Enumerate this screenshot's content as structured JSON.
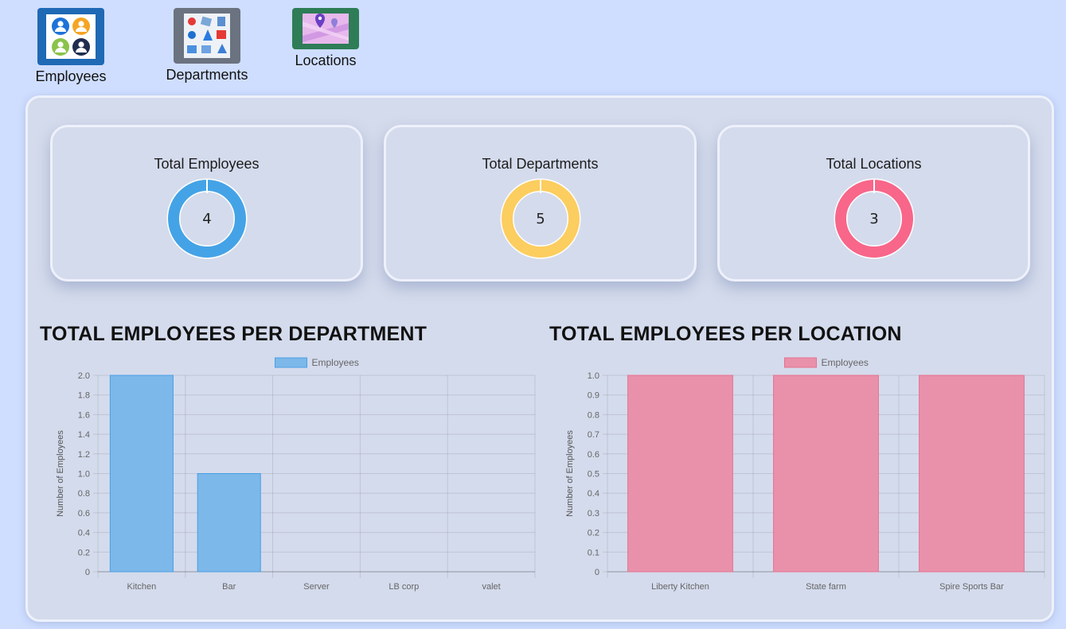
{
  "nav": {
    "items": [
      {
        "label": "Employees",
        "icon": "employees-avatars-icon",
        "color": "#1f69b5"
      },
      {
        "label": "Departments",
        "icon": "departments-grid-icon",
        "color": "#6b7280"
      },
      {
        "label": "Locations",
        "icon": "locations-map-pin-icon",
        "color": "#2e7d57"
      }
    ]
  },
  "stats": [
    {
      "title": "Total Employees",
      "value": "4",
      "color": "#44a3e6"
    },
    {
      "title": "Total Departments",
      "value": "5",
      "color": "#fccd5f"
    },
    {
      "title": "Total Locations",
      "value": "3",
      "color": "#f8668a"
    }
  ],
  "charts": {
    "department": {
      "title": "TOTAL EMPLOYEES PER DEPARTMENT"
    },
    "location": {
      "title": "TOTAL EMPLOYEES PER LOCATION"
    }
  },
  "chart_data": [
    {
      "type": "bar",
      "title": "TOTAL EMPLOYEES PER DEPARTMENT",
      "xlabel": "",
      "ylabel": "Number of Employees",
      "categories": [
        "Kitchen",
        "Bar",
        "Server",
        "LB corp",
        "valet"
      ],
      "series": [
        {
          "name": "Employees",
          "values": [
            2,
            1,
            0,
            0,
            0
          ]
        }
      ],
      "ylim": [
        0,
        2.0
      ],
      "yticks": [
        "0",
        "0.2",
        "0.4",
        "0.6",
        "0.8",
        "1.0",
        "1.2",
        "1.4",
        "1.6",
        "1.8",
        "2.0"
      ],
      "legend": "top",
      "grid": true,
      "bar_color": "#7cb8e9",
      "border_color": "#4a9fe6"
    },
    {
      "type": "bar",
      "title": "TOTAL EMPLOYEES PER LOCATION",
      "xlabel": "",
      "ylabel": "Number of Employees",
      "categories": [
        "Liberty Kitchen",
        "State farm",
        "Spire Sports Bar"
      ],
      "series": [
        {
          "name": "Employees",
          "values": [
            1,
            1,
            1
          ]
        }
      ],
      "ylim": [
        0,
        1.0
      ],
      "yticks": [
        "0",
        "0.1",
        "0.2",
        "0.3",
        "0.4",
        "0.5",
        "0.6",
        "0.7",
        "0.8",
        "0.9",
        "1.0"
      ],
      "legend": "top",
      "grid": true,
      "bar_color": "#e991ab",
      "border_color": "#e7708f"
    }
  ]
}
